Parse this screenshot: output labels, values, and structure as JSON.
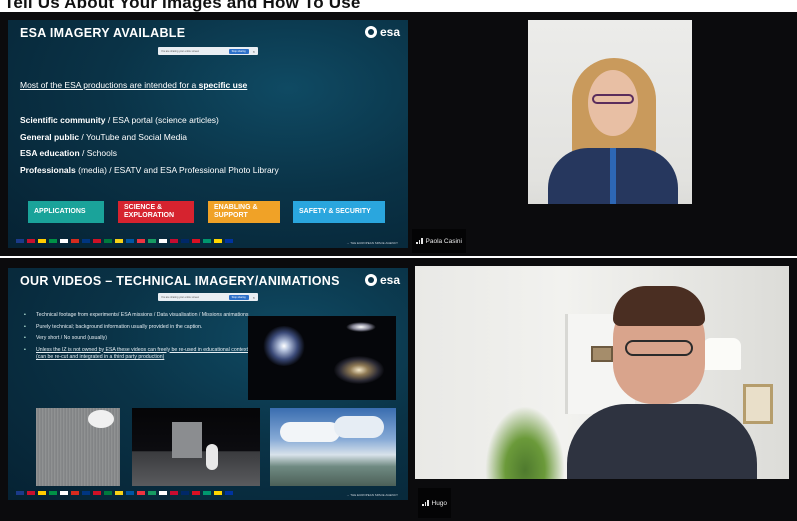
{
  "page": {
    "title": "Tell Us About Your Images and How To Use"
  },
  "slide1": {
    "title": "ESA IMAGERY AVAILABLE",
    "logo_text": "esa",
    "share_bar": {
      "text": "You are sharing your entire screen",
      "button": "Stop sharing",
      "close": "×"
    },
    "intro_prefix": "Most of the ESA productions are intended for a ",
    "intro_bold": "specific use",
    "audiences": [
      {
        "bold": "Scientific community",
        "rest": " / ESA portal (science articles)"
      },
      {
        "bold": "General public",
        "rest": " / YouTube and Social Media"
      },
      {
        "bold": "ESA education",
        "rest": " / Schools"
      },
      {
        "bold": "Professionals",
        "rest": " (media) / ESATV and ESA Professional Photo Library"
      }
    ],
    "categories": [
      {
        "label": "APPLICATIONS",
        "color": "#1aa39a"
      },
      {
        "label": "SCIENCE & EXPLORATION",
        "color": "#d6232f"
      },
      {
        "label": "ENABLING & SUPPORT",
        "color": "#f0a227"
      },
      {
        "label": "SAFETY & SECURITY",
        "color": "#2aa6de"
      }
    ],
    "footer_agency": "→ THE EUROPEAN SPACE AGENCY"
  },
  "slide2": {
    "title": "OUR VIDEOS – TECHNICAL IMAGERY/ANIMATIONS",
    "logo_text": "esa",
    "share_bar": {
      "text": "You are sharing your entire screen",
      "button": "Stop sharing",
      "close": "×"
    },
    "bullets": [
      "Technical footage from experiments/ ESA missions / Data visualisation / Missions animations",
      "Purely technical; background information usually provided in the caption.",
      "Very short / No sound (usually)",
      "Unless the IZ is not owned by ESA these videos can freely be re-used in educational contexts (can be re-cut and integrated in a third party production)"
    ],
    "footer_agency": "→ THE EUROPEAN SPACE AGENCY"
  },
  "participants": {
    "paola": {
      "name": "Paola Casini"
    },
    "hugo": {
      "name": "Hugo"
    }
  },
  "flags": [
    "#1b3a8a",
    "#c8102e",
    "#ffcc00",
    "#009246",
    "#ffffff",
    "#d52b1e",
    "#003580",
    "#ce1126",
    "#007a3d",
    "#f7d117",
    "#0055a4",
    "#ef3340",
    "#169b62",
    "#ffffff",
    "#c60c30",
    "#002868",
    "#d91023",
    "#00966e",
    "#ffd700",
    "#0033a0"
  ]
}
